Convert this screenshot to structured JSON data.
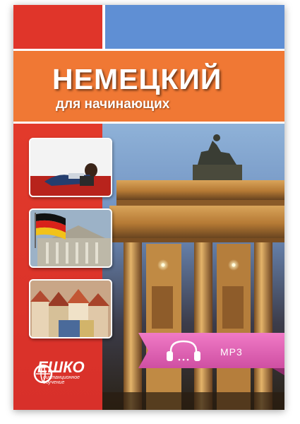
{
  "cover": {
    "title": "НЕМЕЦКИЙ",
    "subtitle": "для начинающих"
  },
  "logo": {
    "name": "ЕШКО",
    "caption_line1": "дистанционное",
    "caption_line2": "обучение"
  },
  "badge": {
    "label": "MP3",
    "icon": "headphones-icon"
  },
  "thumbnails": [
    {
      "icon": "woman-with-laptop-photo"
    },
    {
      "icon": "reichstag-flag-photo"
    },
    {
      "icon": "old-town-roofs-photo"
    }
  ],
  "colors": {
    "red": "#e0352a",
    "blue": "#5f8fd4",
    "orange": "#f07834",
    "ribbon_pink": "#e05fb0"
  }
}
